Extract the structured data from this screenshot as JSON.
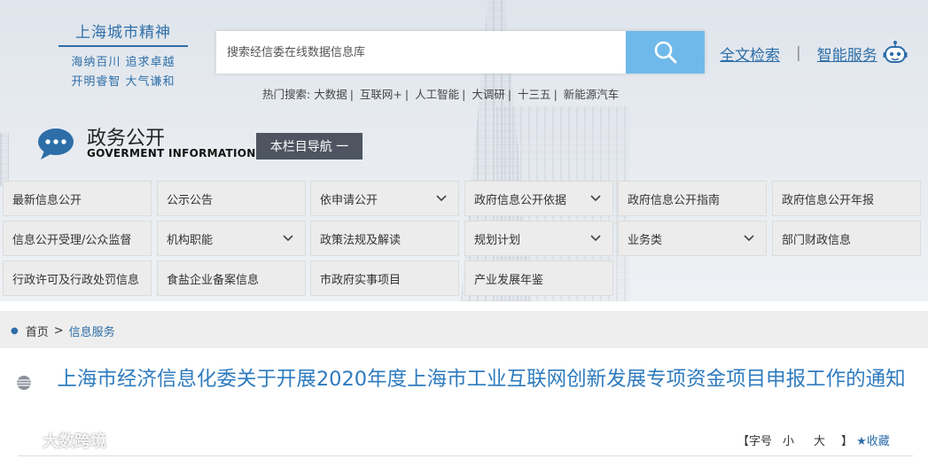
{
  "logo": {
    "line1": "上海城市精神",
    "line2": "海纳百川 追求卓越",
    "line3": "开明睿智 大气谦和"
  },
  "search": {
    "placeholder": "搜索经信委在线数据信息库"
  },
  "hot": {
    "label": "热门搜索:",
    "terms": [
      "大数据",
      "互联网+",
      "人工智能",
      "大调研",
      "十三五",
      "新能源汽车"
    ]
  },
  "top_links": {
    "fulltext": "全文检索",
    "separator": "|",
    "smart": "智能服务"
  },
  "section": {
    "title": "政务公开",
    "subtitle": "GOVERMENT INFORMATION",
    "nav_button": "本栏目导航 一"
  },
  "menu": [
    {
      "label": "最新信息公开",
      "dropdown": false
    },
    {
      "label": "公示公告",
      "dropdown": false
    },
    {
      "label": "依申请公开",
      "dropdown": true
    },
    {
      "label": "政府信息公开依据",
      "dropdown": true
    },
    {
      "label": "政府信息公开指南",
      "dropdown": false
    },
    {
      "label": "政府信息公开年报",
      "dropdown": false
    },
    {
      "label": "信息公开受理/公众监督",
      "dropdown": false
    },
    {
      "label": "机构职能",
      "dropdown": true
    },
    {
      "label": "政策法规及解读",
      "dropdown": false
    },
    {
      "label": "规划计划",
      "dropdown": true
    },
    {
      "label": "业务类",
      "dropdown": true
    },
    {
      "label": "部门财政信息",
      "dropdown": false
    },
    {
      "label": "行政许可及行政处罚信息",
      "dropdown": false
    },
    {
      "label": "食盐企业备案信息",
      "dropdown": false
    },
    {
      "label": "市政府实事项目",
      "dropdown": false
    },
    {
      "label": "产业发展年鉴",
      "dropdown": false
    }
  ],
  "breadcrumb": {
    "home": "首页",
    "sep": ">",
    "current": "信息服务"
  },
  "article": {
    "title": "上海市经济信息化委关于开展2020年度上海市工业互联网创新发展专项资金项目申报工作的通知"
  },
  "font_size": {
    "open": "【字号",
    "small": "小",
    "large": "大",
    "close": "】",
    "favorite": "★收藏"
  },
  "watermark": {
    "text": "大数跨境"
  },
  "colors": {
    "accent": "#2d6ea8",
    "search_button": "#6fb9ea",
    "nav_button": "#4e5561",
    "title": "#2e7bbf"
  }
}
